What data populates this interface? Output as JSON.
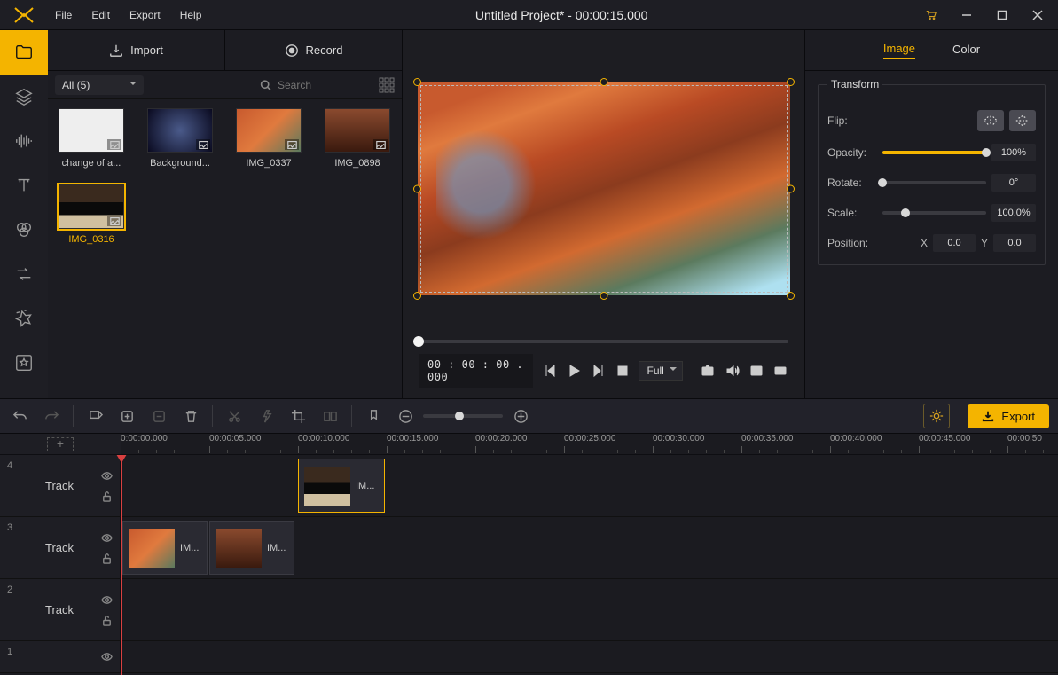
{
  "app": {
    "title": "Untitled Project* - 00:00:15.000"
  },
  "menu": {
    "file": "File",
    "edit": "Edit",
    "export": "Export",
    "help": "Help"
  },
  "media": {
    "import_label": "Import",
    "record_label": "Record",
    "filter_label": "All (5)",
    "search_placeholder": "Search",
    "items": [
      {
        "name": "change of a..."
      },
      {
        "name": "Background..."
      },
      {
        "name": "IMG_0337"
      },
      {
        "name": "IMG_0898"
      },
      {
        "name": "IMG_0316"
      }
    ]
  },
  "preview": {
    "timecode": "00 : 00 : 00 . 000",
    "scale_label": "Full"
  },
  "props": {
    "tab_image": "Image",
    "tab_color": "Color",
    "transform_legend": "Transform",
    "flip_label": "Flip:",
    "opacity_label": "Opacity:",
    "opacity_value": "100%",
    "rotate_label": "Rotate:",
    "rotate_value": "0°",
    "scale_label": "Scale:",
    "scale_value": "100.0%",
    "position_label": "Position:",
    "pos_x_label": "X",
    "pos_x_value": "0.0",
    "pos_y_label": "Y",
    "pos_y_value": "0.0"
  },
  "toolbar": {
    "export_label": "Export"
  },
  "timeline": {
    "ticks": [
      "0:00:00.000",
      "00:00:05.000",
      "00:00:10.000",
      "00:00:15.000",
      "00:00:20.000",
      "00:00:25.000",
      "00:00:30.000",
      "00:00:35.000",
      "00:00:40.000",
      "00:00:45.000",
      "00:00:50"
    ],
    "track_label": "Track",
    "tracks": [
      {
        "num": "4",
        "label": "Track"
      },
      {
        "num": "3",
        "label": "Track"
      },
      {
        "num": "2",
        "label": "Track"
      },
      {
        "num": "1",
        "label": ""
      }
    ],
    "clips": {
      "t4c1": "IM...",
      "t3c1": "IM...",
      "t3c2": "IM..."
    }
  }
}
